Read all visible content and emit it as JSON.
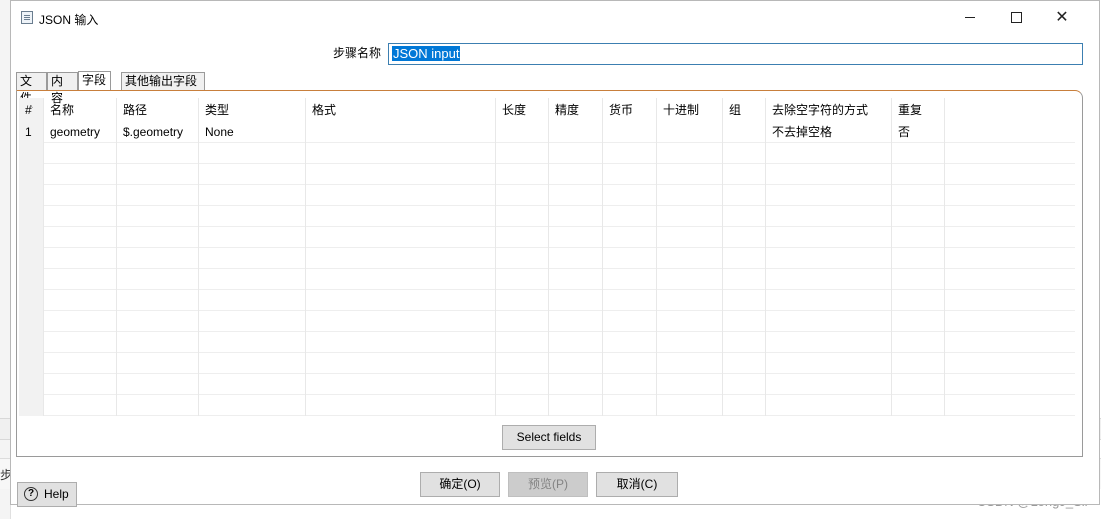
{
  "window": {
    "title": "JSON 输入"
  },
  "step": {
    "label": "步骤名称",
    "value": "JSON input"
  },
  "tabs": [
    "文件",
    "内容",
    "字段",
    "其他输出字段"
  ],
  "table": {
    "columns": [
      "#",
      "名称",
      "路径",
      "类型",
      "格式",
      "长度",
      "精度",
      "货币",
      "十进制",
      "组",
      "去除空字符的方式",
      "重复"
    ],
    "rows": [
      [
        "1",
        "geometry",
        "$.geometry",
        "None",
        "",
        "",
        "",
        "",
        "",
        "",
        "不去掉空格",
        "否"
      ]
    ]
  },
  "buttons": {
    "select_fields": "Select fields",
    "ok": "确定(O)",
    "preview": "预览(P)",
    "cancel": "取消(C)",
    "help": "Help"
  },
  "background": {
    "step_fragment": "步",
    "watermark": "CSDN @LongJ_Sir"
  }
}
